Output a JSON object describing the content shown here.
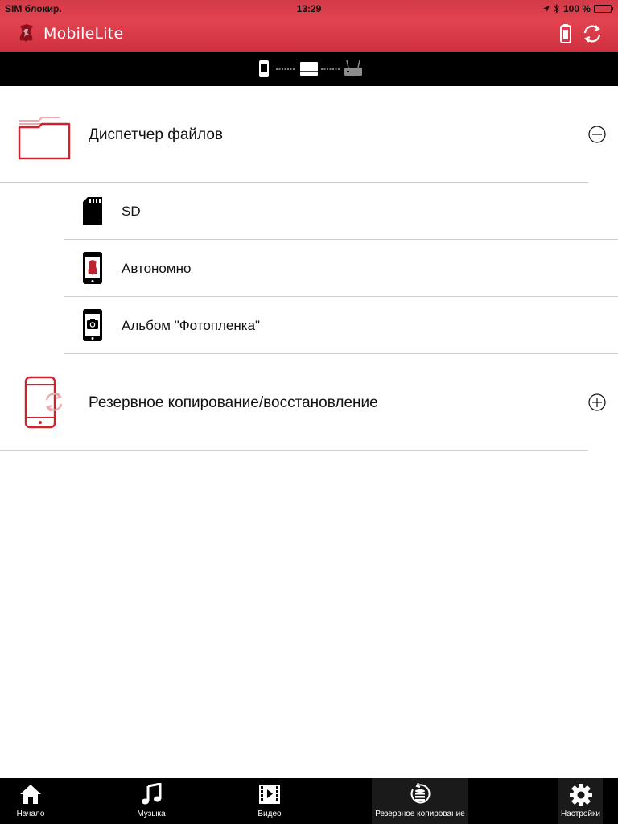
{
  "status": {
    "carrier": "SIM блокир.",
    "time": "13:29",
    "battery": "100 %",
    "battery_level": 1.0
  },
  "header": {
    "title": "MobileLite"
  },
  "colors": {
    "accent": "#e2434f",
    "icon_red": "#d3202f",
    "bar": "#000000"
  },
  "sections": [
    {
      "label": "Диспетчер файлов",
      "icon": "folder-icon",
      "expanded": true,
      "toggle_icon": "minus-circle-icon"
    },
    {
      "label": "Резервное копирование/восстановление",
      "icon": "phone-sync-icon",
      "expanded": false,
      "toggle_icon": "plus-circle-icon"
    }
  ],
  "file_manager_items": [
    {
      "label": "SD",
      "icon": "sd-card-icon"
    },
    {
      "label": "Автономно",
      "icon": "phone-kingston-icon"
    },
    {
      "label": "Альбом \"Фотопленка\"",
      "icon": "phone-camera-icon"
    }
  ],
  "tabs": [
    {
      "label": "Начало",
      "icon": "home-icon"
    },
    {
      "label": "Музыка",
      "icon": "music-icon"
    },
    {
      "label": "Видео",
      "icon": "video-icon"
    },
    {
      "label": "Резервное копирование",
      "icon": "backup-icon"
    },
    {
      "label": "Настройки",
      "icon": "gear-icon"
    }
  ]
}
